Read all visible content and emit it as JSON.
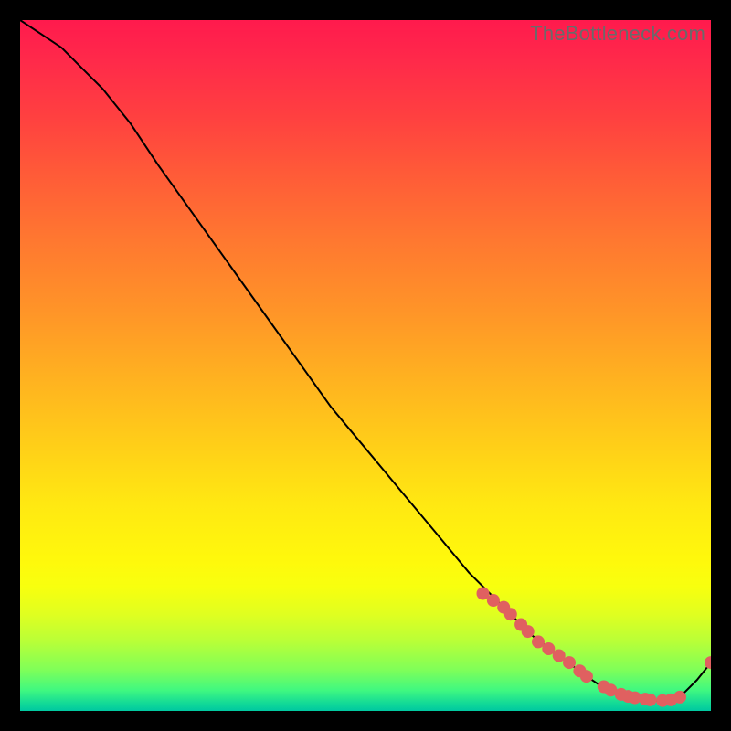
{
  "watermark": "TheBottleneck.com",
  "chart_data": {
    "type": "line",
    "title": "",
    "xlabel": "",
    "ylabel": "",
    "xlim": [
      0,
      100
    ],
    "ylim": [
      0,
      100
    ],
    "series": [
      {
        "name": "curve",
        "x": [
          0,
          3,
          6,
          9,
          12,
          16,
          20,
          25,
          30,
          35,
          40,
          45,
          50,
          55,
          60,
          65,
          70,
          74,
          78,
          82,
          85,
          88,
          91,
          94,
          96,
          98,
          100
        ],
        "y": [
          100,
          98,
          96,
          93,
          90,
          85,
          79,
          72,
          65,
          58,
          51,
          44,
          38,
          32,
          26,
          20,
          15,
          11,
          8,
          5,
          3,
          2,
          1.5,
          1.5,
          2.5,
          4.5,
          7
        ]
      }
    ],
    "highlight_points": {
      "name": "dots",
      "x": [
        67,
        68.5,
        70,
        71,
        72.5,
        73.5,
        75,
        76.5,
        78,
        79.5,
        81,
        82,
        84.5,
        85.5,
        87,
        88,
        89,
        90.5,
        91.2,
        93,
        94.2,
        95.5,
        100
      ],
      "y": [
        17,
        16,
        15,
        14,
        12.5,
        11.5,
        10,
        9,
        8,
        7,
        5.8,
        5,
        3.5,
        3,
        2.4,
        2.1,
        1.9,
        1.7,
        1.6,
        1.5,
        1.6,
        2.0,
        7
      ]
    },
    "colors": {
      "curve": "#000000",
      "dots": "#e06060"
    }
  }
}
